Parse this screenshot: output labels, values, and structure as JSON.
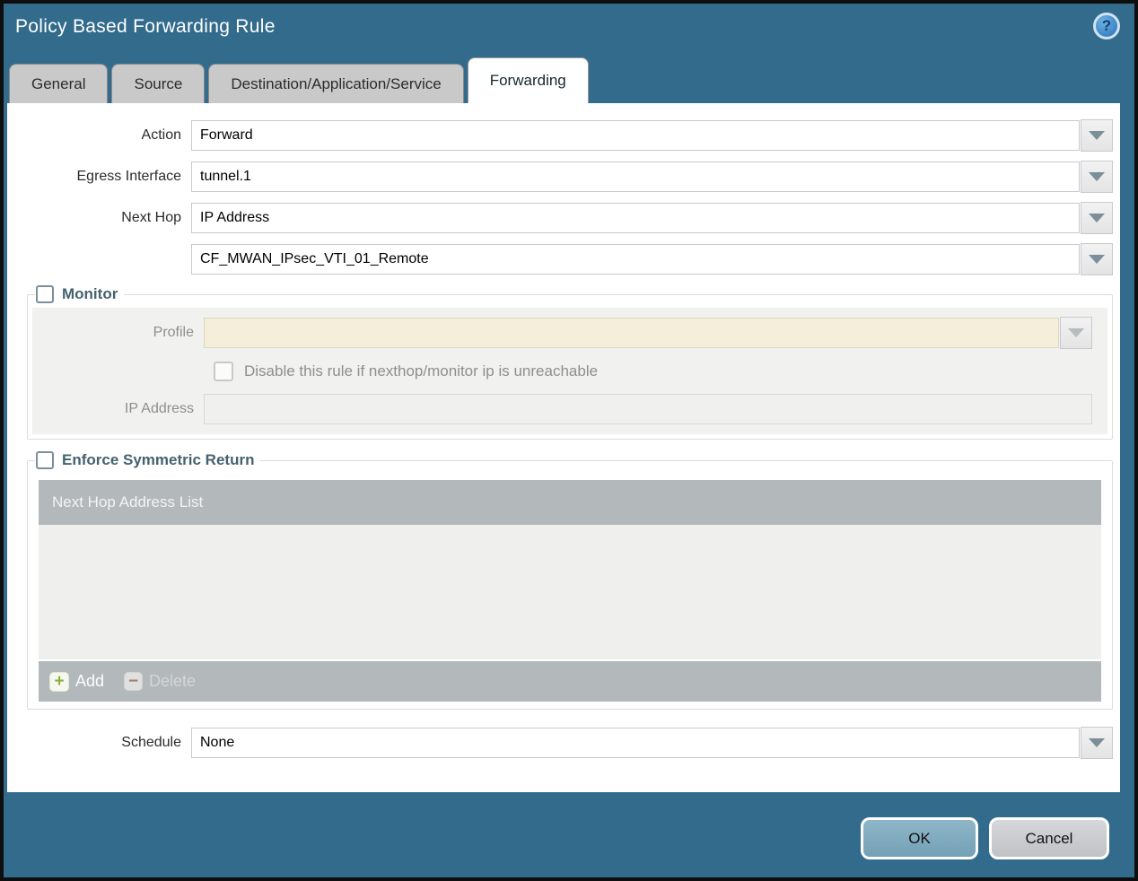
{
  "dialog": {
    "title": "Policy Based Forwarding Rule"
  },
  "tabs": [
    {
      "label": "General",
      "active": false
    },
    {
      "label": "Source",
      "active": false
    },
    {
      "label": "Destination/Application/Service",
      "active": false
    },
    {
      "label": "Forwarding",
      "active": true
    }
  ],
  "form": {
    "action": {
      "label": "Action",
      "value": "Forward"
    },
    "egress_interface": {
      "label": "Egress Interface",
      "value": "tunnel.1"
    },
    "next_hop": {
      "label": "Next Hop",
      "value": "IP Address"
    },
    "next_hop_address": {
      "value": "CF_MWAN_IPsec_VTI_01_Remote"
    },
    "schedule": {
      "label": "Schedule",
      "value": "None"
    }
  },
  "monitor": {
    "title": "Monitor",
    "checked": false,
    "profile": {
      "label": "Profile",
      "value": ""
    },
    "disable_rule": {
      "label": "Disable this rule if nexthop/monitor ip is unreachable",
      "checked": false
    },
    "ip_address": {
      "label": "IP Address",
      "value": ""
    }
  },
  "symmetric_return": {
    "title": "Enforce Symmetric Return",
    "checked": false,
    "table": {
      "header": "Next Hop Address List",
      "rows": []
    },
    "add_label": "Add",
    "delete_label": "Delete"
  },
  "footer": {
    "ok_label": "OK",
    "cancel_label": "Cancel"
  },
  "icons": {
    "help": "?",
    "add": "+",
    "delete": "−"
  },
  "colors": {
    "titlebar_teal": "#326b8c",
    "tab_inactive": "#c9c9c9",
    "section_title": "#45626f",
    "profile_field_bg": "#f5eedb",
    "table_header_bg": "#b3b8ba",
    "add_icon_green": "#8fae3e",
    "delete_icon_red": "#ad7a6d",
    "ok_button": "#7fa9bd",
    "cancel_button": "#c9cacd"
  }
}
